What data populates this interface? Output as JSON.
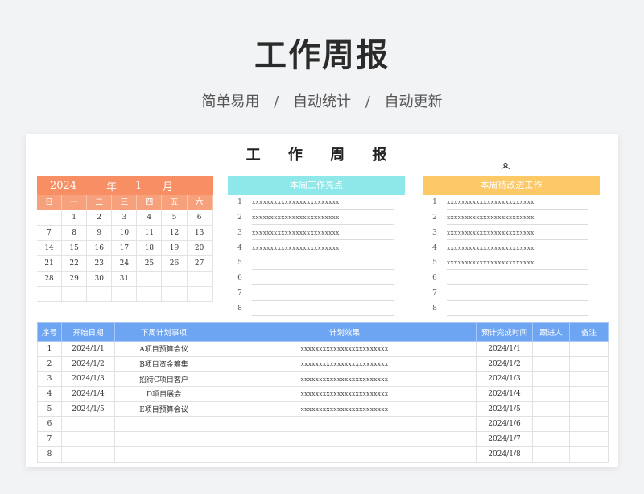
{
  "hero": {
    "title": "工作周报",
    "subtitle_parts": [
      "简单易用",
      "/",
      "自动统计",
      "/",
      "自动更新"
    ]
  },
  "sheet": {
    "title": "工 作 周 报"
  },
  "calendar": {
    "year": "2024",
    "year_unit": "年",
    "month": "1",
    "month_unit": "月",
    "weekdays": [
      "日",
      "一",
      "二",
      "三",
      "四",
      "五",
      "六"
    ],
    "cells": [
      "",
      "1",
      "2",
      "3",
      "4",
      "5",
      "6",
      "7",
      "8",
      "9",
      "10",
      "11",
      "12",
      "13",
      "14",
      "15",
      "16",
      "17",
      "18",
      "19",
      "20",
      "21",
      "22",
      "23",
      "24",
      "25",
      "26",
      "27",
      "28",
      "29",
      "30",
      "31",
      "",
      "",
      "",
      "",
      "",
      "",
      "",
      "",
      "",
      ""
    ],
    "head_color": "#f88e64"
  },
  "highlights": {
    "header": "本周工作亮点",
    "color": "#8ee8ea",
    "rows": [
      {
        "num": "1",
        "text": "xxxxxxxxxxxxxxxxxxxxxxxx"
      },
      {
        "num": "2",
        "text": "xxxxxxxxxxxxxxxxxxxxxxxx"
      },
      {
        "num": "3",
        "text": "xxxxxxxxxxxxxxxxxxxxxxxx"
      },
      {
        "num": "4",
        "text": "xxxxxxxxxxxxxxxxxxxxxxxx"
      },
      {
        "num": "5",
        "text": ""
      },
      {
        "num": "6",
        "text": ""
      },
      {
        "num": "7",
        "text": ""
      },
      {
        "num": "8",
        "text": ""
      }
    ]
  },
  "improvements": {
    "header": "本周待改进工作",
    "color": "#fdc866",
    "rows": [
      {
        "num": "1",
        "text": "xxxxxxxxxxxxxxxxxxxxxxxx"
      },
      {
        "num": "2",
        "text": "xxxxxxxxxxxxxxxxxxxxxxxx"
      },
      {
        "num": "3",
        "text": "xxxxxxxxxxxxxxxxxxxxxxxx"
      },
      {
        "num": "4",
        "text": "xxxxxxxxxxxxxxxxxxxxxxxx"
      },
      {
        "num": "5",
        "text": "xxxxxxxxxxxxxxxxxxxxxxxx"
      },
      {
        "num": "6",
        "text": ""
      },
      {
        "num": "7",
        "text": ""
      },
      {
        "num": "8",
        "text": ""
      }
    ]
  },
  "plan": {
    "header_color": "#6ea5f2",
    "columns": [
      "序号",
      "开始日期",
      "下周计划事项",
      "计划效果",
      "预计完成时间",
      "跟进人",
      "备注"
    ],
    "rows": [
      [
        "1",
        "2024/1/1",
        "A项目预算会议",
        "xxxxxxxxxxxxxxxxxxxxxxxx",
        "2024/1/1",
        "",
        ""
      ],
      [
        "2",
        "2024/1/2",
        "B项目资金筹集",
        "xxxxxxxxxxxxxxxxxxxxxxxx",
        "2024/1/2",
        "",
        ""
      ],
      [
        "3",
        "2024/1/3",
        "招待C项目客户",
        "xxxxxxxxxxxxxxxxxxxxxxxx",
        "2024/1/3",
        "",
        ""
      ],
      [
        "4",
        "2024/1/4",
        "D项目展会",
        "xxxxxxxxxxxxxxxxxxxxxxxx",
        "2024/1/4",
        "",
        ""
      ],
      [
        "5",
        "2024/1/5",
        "E项目预算会议",
        "xxxxxxxxxxxxxxxxxxxxxxxx",
        "2024/1/5",
        "",
        ""
      ],
      [
        "6",
        "",
        "",
        "",
        "2024/1/6",
        "",
        ""
      ],
      [
        "7",
        "",
        "",
        "",
        "2024/1/7",
        "",
        ""
      ],
      [
        "8",
        "",
        "",
        "",
        "2024/1/8",
        "",
        ""
      ]
    ]
  }
}
